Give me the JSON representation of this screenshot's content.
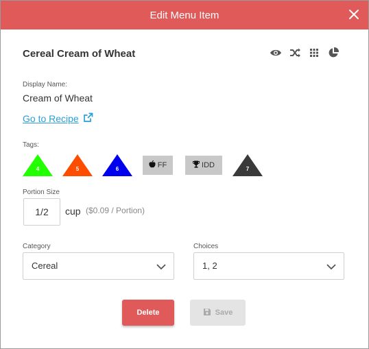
{
  "header": {
    "title": "Edit Menu Item"
  },
  "item": {
    "title": "Cereal Cream of Wheat",
    "display_name_label": "Display Name:",
    "display_name": "Cream of Wheat",
    "recipe_link": "Go to Recipe"
  },
  "tags": {
    "label": "Tags:",
    "triangles": [
      {
        "number": "4",
        "color": "#22ff00"
      },
      {
        "number": "5",
        "color": "#ff4d00"
      },
      {
        "number": "6",
        "color": "#0000ee"
      },
      {
        "number": "7",
        "color": "#3a3a3a"
      }
    ],
    "boxes": [
      {
        "label": "FF",
        "icon": "apple-icon"
      },
      {
        "label": "IDD",
        "icon": "trophy-icon"
      }
    ]
  },
  "portion": {
    "label": "Portion Size",
    "value": "1/2",
    "unit": "cup",
    "price": "($0.09 / Portion)"
  },
  "category": {
    "label": "Category",
    "value": "Cereal"
  },
  "choices": {
    "label": "Choices",
    "value": "1, 2"
  },
  "actions": {
    "delete_label": "Delete",
    "save_label": "Save"
  },
  "colors": {
    "accent": "#e05a5a",
    "link": "#2a9fd6",
    "icon": "#555555"
  }
}
